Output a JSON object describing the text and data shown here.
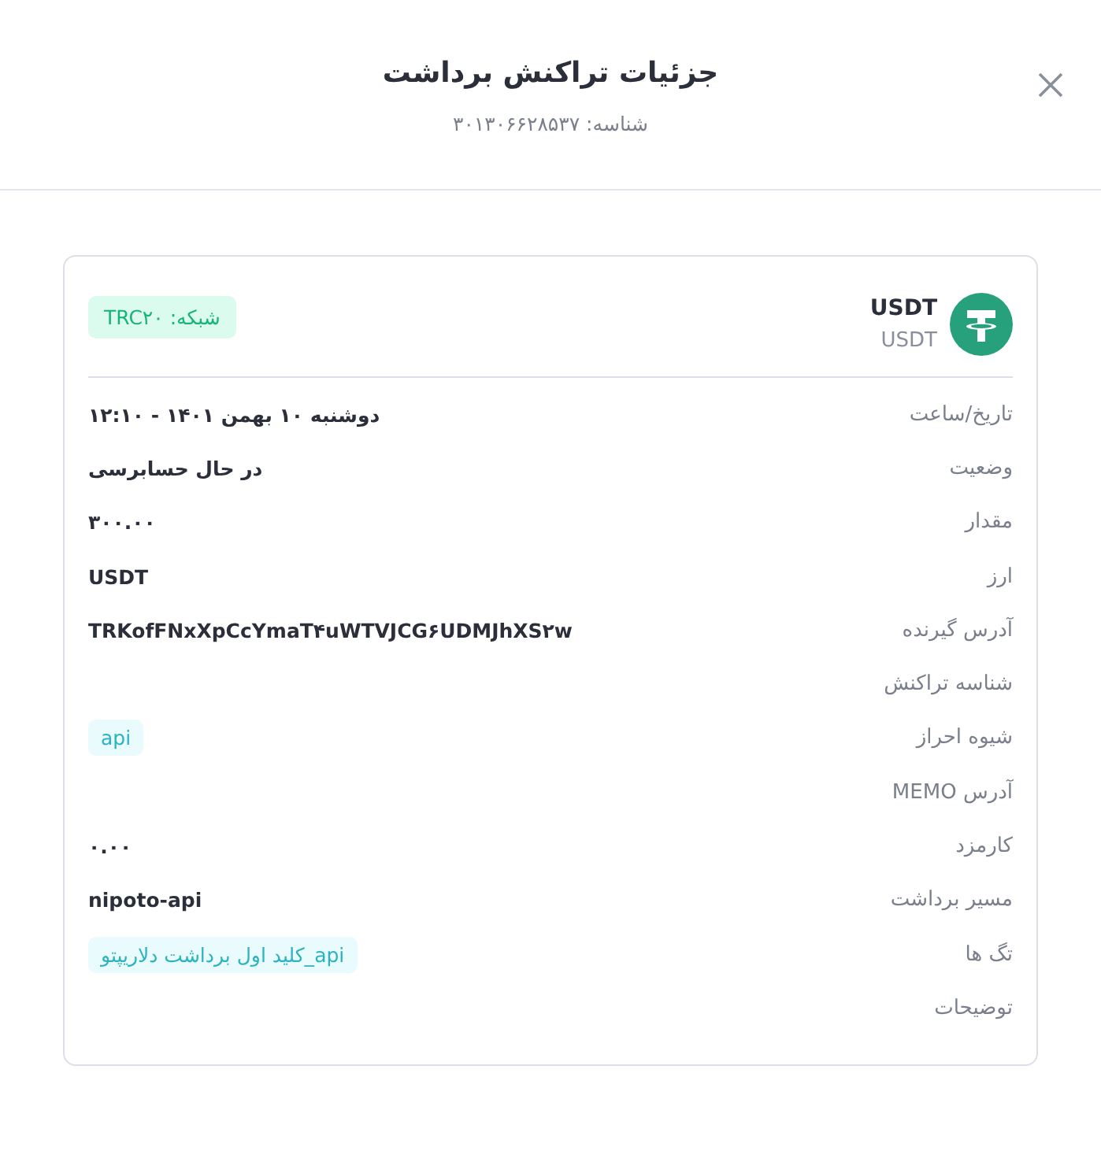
{
  "dialog": {
    "title": "جزئیات تراکنش برداشت",
    "subtitle": "شناسه: ۳۰۱۳۰۶۶۲۸۵۳۷"
  },
  "asset": {
    "name": "USDT",
    "symbol": "USDT",
    "network": "شبکه: TRC۲۰"
  },
  "rows": [
    {
      "kind": "text",
      "label": "تاریخ/ساعت",
      "value": "دوشنبه ۱۰ بهمن ۱۴۰۱ - ۱۲:۱۰"
    },
    {
      "kind": "text",
      "label": "وضعیت",
      "value": "در حال حسابرسی"
    },
    {
      "kind": "text",
      "label": "مقدار",
      "value": "۳۰۰.۰۰"
    },
    {
      "kind": "text",
      "label": "ارز",
      "value": "USDT"
    },
    {
      "kind": "text",
      "label": "آدرس گیرنده",
      "value": "TRKofFNxXpCcYmaT۴uWTVJCG۶UDMJhXS۲w"
    },
    {
      "kind": "empty",
      "label": "شناسه تراکنش"
    },
    {
      "kind": "tag",
      "label": "شیوه احراز",
      "value": "api"
    },
    {
      "kind": "empty",
      "label": "آدرس MEMO"
    },
    {
      "kind": "text",
      "label": "کارمزد",
      "value": "۰.۰۰"
    },
    {
      "kind": "text",
      "label": "مسیر برداشت",
      "value": "nipoto-api"
    },
    {
      "kind": "tag",
      "label": "تگ ها",
      "value": "api_کلید اول برداشت دلاریپتو"
    },
    {
      "kind": "empty",
      "label": "توضیحات"
    }
  ]
}
